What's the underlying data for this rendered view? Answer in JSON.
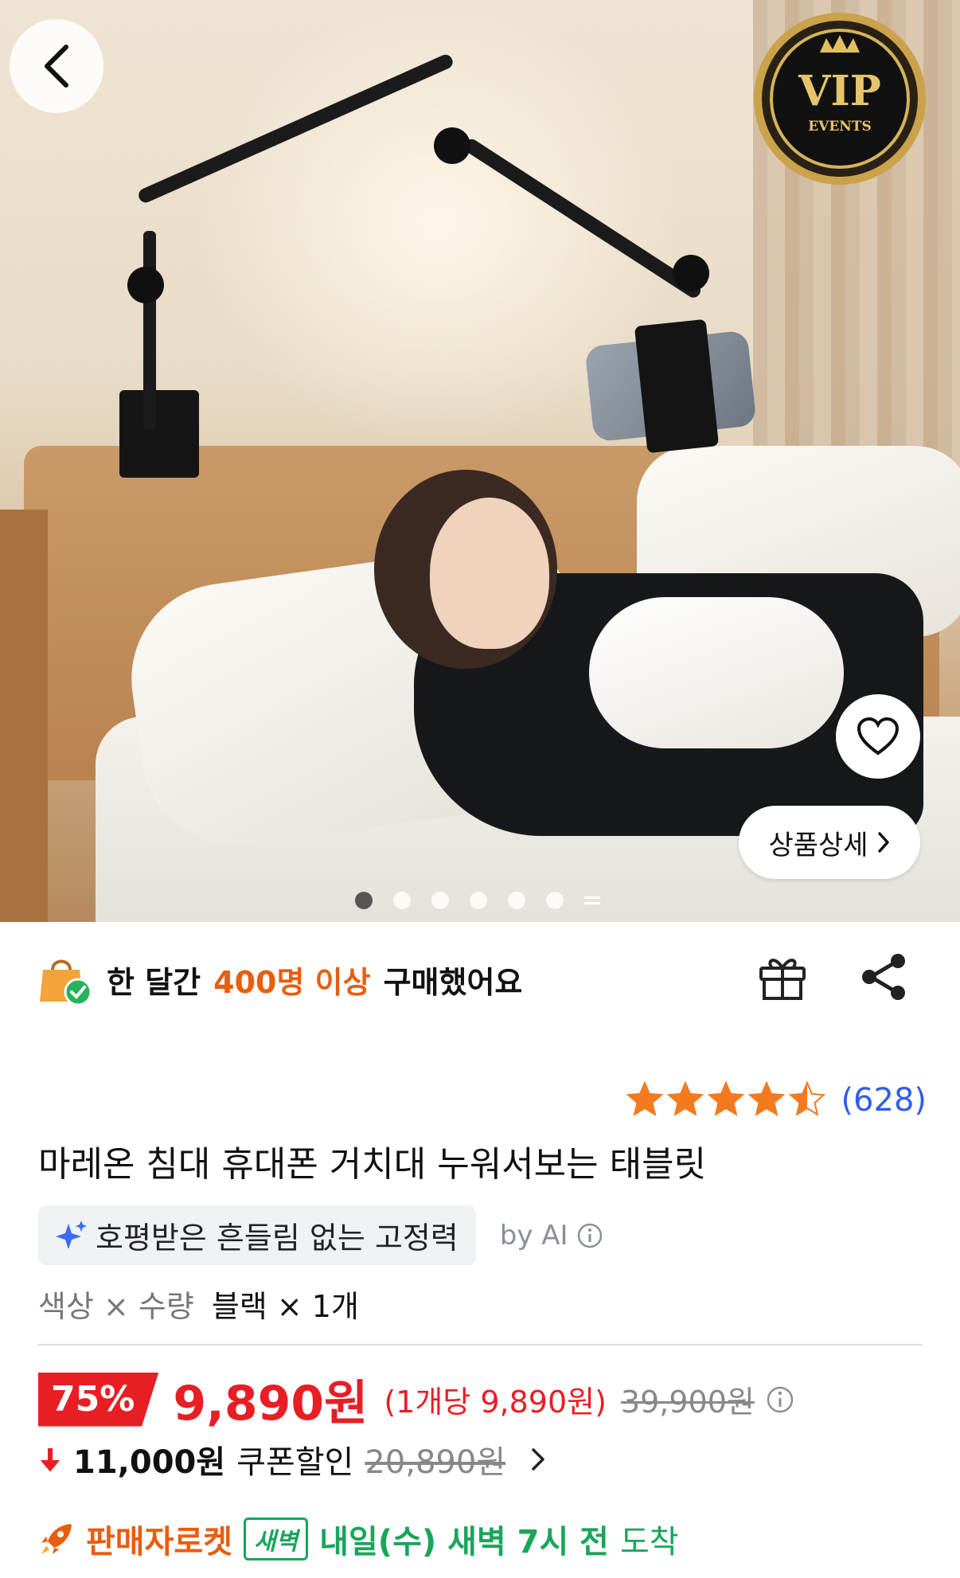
{
  "hero": {
    "badge": {
      "line1": "VIP",
      "line2": "EVENTS"
    },
    "detail_label": "상품상세",
    "slide_count": 6,
    "active_slide": 1
  },
  "buyers": {
    "prefix": "한 달간",
    "highlight": "400명 이상",
    "suffix": "구매했어요"
  },
  "rating": {
    "stars": 4.5,
    "count": "(628)"
  },
  "product": {
    "title": "마레온 침대 휴대폰 거치대 누워서보는 태블릿"
  },
  "ai_summary": {
    "text": "호평받은 흔들림 없는 고정력",
    "by": "by AI"
  },
  "options": {
    "label": "색상 × 수량",
    "value": "블랙 × 1개"
  },
  "price": {
    "discount": "75%",
    "sale": "9,890원",
    "unit": "(1개당 9,890원)",
    "original": "39,900원"
  },
  "coupon": {
    "amount": "11,000원",
    "label": "쿠폰할인",
    "was": "20,890원"
  },
  "shipping": {
    "brand": "판매자로켓",
    "tag": "새벽",
    "when": "내일(수) 새벽 7시 전",
    "arrive": "도착"
  },
  "colors": {
    "accent_red": "#e81e25",
    "accent_orange": "#e85d0e",
    "link_blue": "#2f5ee8",
    "green": "#19a55a",
    "star": "#f47a20"
  }
}
